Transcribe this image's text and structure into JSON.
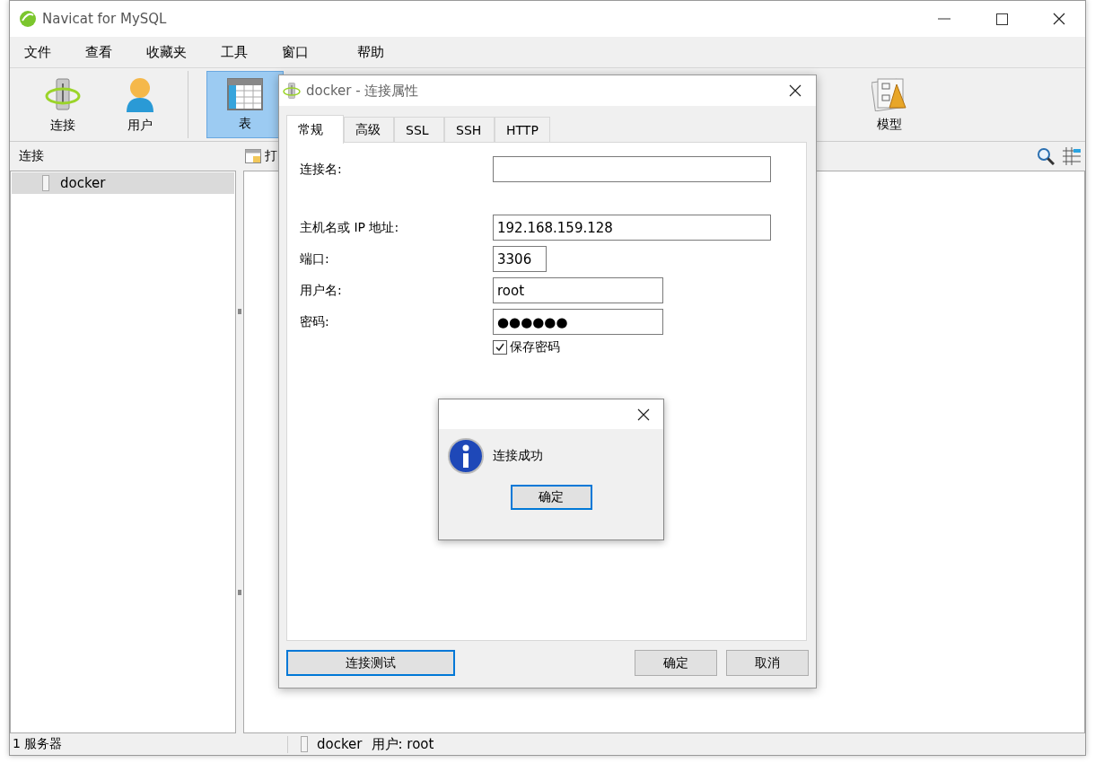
{
  "window": {
    "title": "Navicat for MySQL"
  },
  "menu": [
    {
      "label": "文件"
    },
    {
      "label": "查看"
    },
    {
      "label": "收藏夹"
    },
    {
      "label": "工具"
    },
    {
      "label": "窗口"
    },
    {
      "label": "帮助"
    }
  ],
  "toolbar": [
    {
      "kind": "connection",
      "label": "连接",
      "selected": false
    },
    {
      "kind": "user",
      "label": "用户",
      "selected": false
    },
    {
      "kind": "table",
      "label": "表",
      "selected": true
    },
    {
      "kind": "model",
      "label": "模型",
      "selected": false
    }
  ],
  "connections_header": "连接",
  "object_toolbar": {
    "label": "打"
  },
  "connections": [
    {
      "name": "docker",
      "selected": true
    }
  ],
  "status_bar": {
    "count": "1 服务器",
    "connection": "docker",
    "user": "用户: root"
  },
  "dialog": {
    "title": "docker - 连接属性",
    "tabs": [
      {
        "label": "常规",
        "selected": true
      },
      {
        "label": "高级",
        "selected": false
      },
      {
        "label": "SSL",
        "selected": false
      },
      {
        "label": "SSH",
        "selected": false
      },
      {
        "label": "HTTP",
        "selected": false
      }
    ],
    "groups": [
      [
        {
          "label": "连接名:",
          "kind": "long"
        }
      ],
      [
        {
          "label": "主机名或 IP 地址:",
          "value": "192.168.159.128",
          "kind": "long"
        },
        {
          "label": "端口:",
          "value": "3306",
          "kind": "short"
        },
        {
          "label": "用户名:",
          "value": "root",
          "kind": "medium"
        },
        {
          "label": "密码:",
          "value": "●●●●●●",
          "kind": "medium"
        }
      ]
    ],
    "save_password": {
      "label": "保存密码",
      "checked": true
    },
    "buttons": [
      {
        "label": "连接测试",
        "focused": true
      },
      {
        "label": "确定",
        "focused": false
      },
      {
        "label": "取消",
        "focused": false
      }
    ]
  },
  "message": {
    "text": "连接成功",
    "button": {
      "label": "确定",
      "focused": true
    }
  }
}
